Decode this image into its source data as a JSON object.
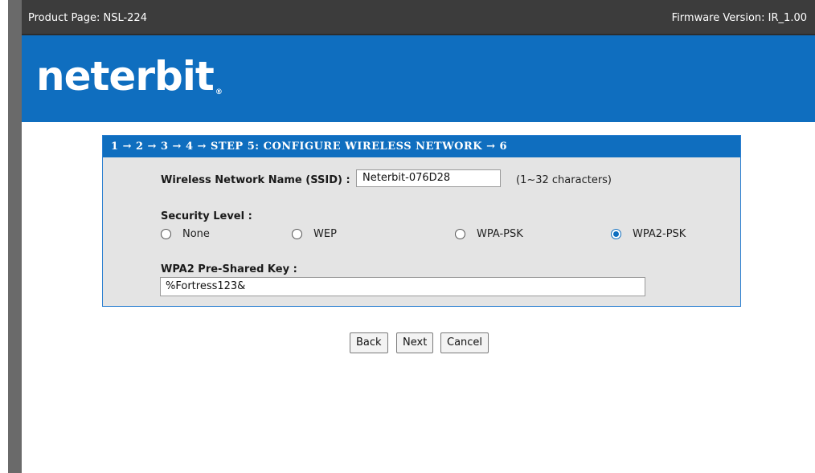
{
  "topbar": {
    "product": "Product Page: NSL-224",
    "firmware": "Firmware Version: IR_1.00"
  },
  "banner": {
    "logo_text": "neterbit",
    "logo_reg": "®"
  },
  "wizard": {
    "steps_text": "1 → 2 → 3 → 4 → STEP 5: CONFIGURE WIRELESS NETWORK → 6"
  },
  "ssid": {
    "label": "Wireless Network Name (SSID) :",
    "value": "Neterbit-076D28",
    "hint": "(1~32 characters)"
  },
  "security": {
    "label": "Security Level :",
    "options": [
      {
        "label": "None",
        "checked": false
      },
      {
        "label": "WEP",
        "checked": false
      },
      {
        "label": "WPA-PSK",
        "checked": false
      },
      {
        "label": "WPA2-PSK",
        "checked": true
      }
    ]
  },
  "psk": {
    "label": "WPA2 Pre-Shared Key :",
    "value": "%Fortress123&"
  },
  "buttons": {
    "back": "Back",
    "next": "Next",
    "cancel": "Cancel"
  },
  "colors": {
    "accent": "#0f6ebf",
    "topbar": "#3c3c3c",
    "panel_bg": "#e4e4e4"
  }
}
